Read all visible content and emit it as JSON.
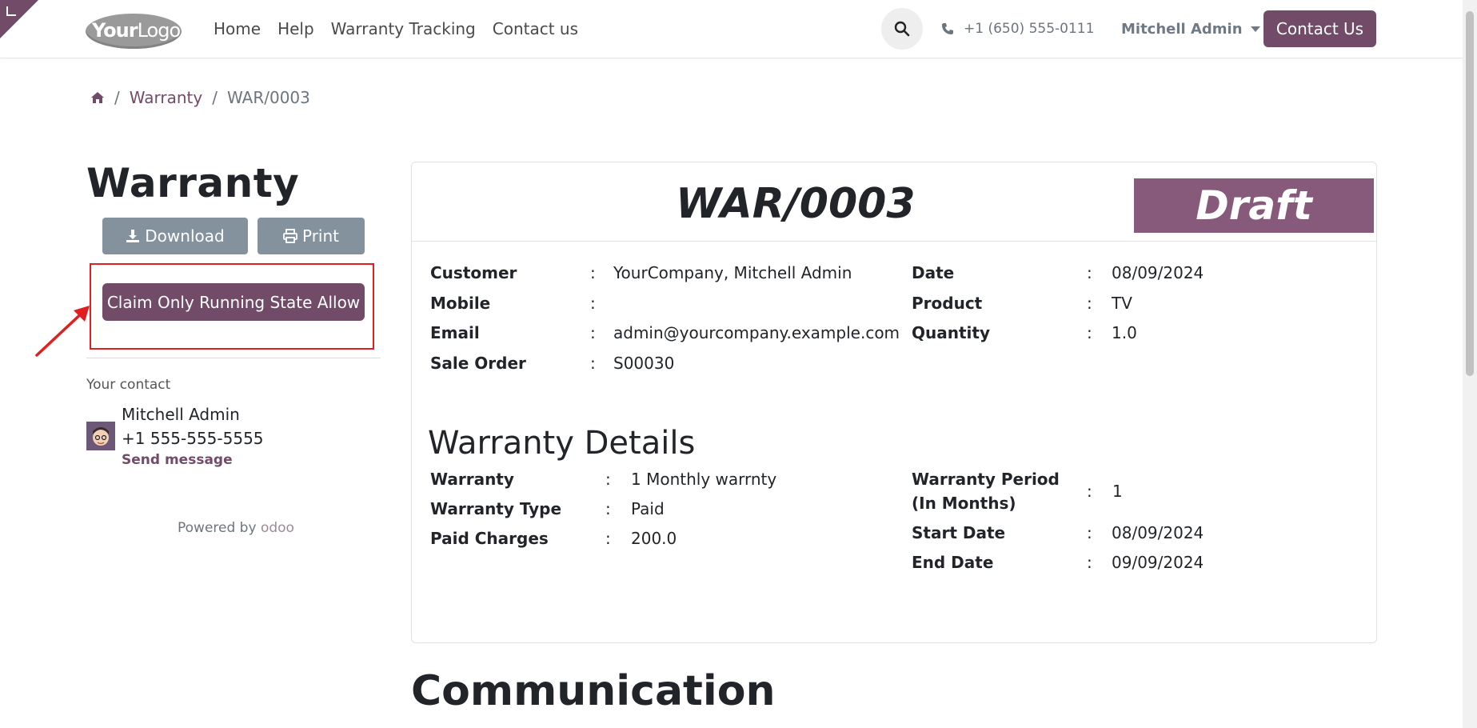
{
  "header": {
    "logo_text_bold": "Your",
    "logo_text_rest": "Logo",
    "nav": [
      "Home",
      "Help",
      "Warranty Tracking",
      "Contact us"
    ],
    "phone": "+1 (650) 555-0111",
    "user": "Mitchell Admin",
    "contact_btn": "Contact Us"
  },
  "breadcrumb": {
    "home_icon": "home-icon",
    "separator": "/",
    "items": [
      "Warranty",
      "WAR/0003"
    ]
  },
  "sidebar": {
    "title": "Warranty",
    "download": "Download",
    "print": "Print",
    "claim": "Claim Only Running State Allow",
    "your_contact": "Your contact",
    "contact_name": "Mitchell Admin",
    "contact_phone": "+1 555-555-5555",
    "send_message": "Send message",
    "powered_by": "Powered by",
    "powered_brand": "odoo"
  },
  "record": {
    "number": "WAR/0003",
    "status": "Draft",
    "left_fields": [
      {
        "label": "Customer",
        "value": "YourCompany, Mitchell Admin"
      },
      {
        "label": "Mobile",
        "value": ""
      },
      {
        "label": "Email",
        "value": "admin@yourcompany.example.com"
      },
      {
        "label": "Sale Order",
        "value": "S00030"
      }
    ],
    "right_fields": [
      {
        "label": "Date",
        "value": "08/09/2024"
      },
      {
        "label": "Product",
        "value": "TV"
      },
      {
        "label": "Quantity",
        "value": "1.0"
      }
    ],
    "details_title": "Warranty Details",
    "detail_left": [
      {
        "label": "Warranty",
        "value": "1 Monthly warrnty"
      },
      {
        "label": "Warranty Type",
        "value": "Paid"
      },
      {
        "label": "Paid Charges",
        "value": "200.0"
      }
    ],
    "detail_right": [
      {
        "label_1": "Warranty Period",
        "label_2": "(In Months)",
        "value": "1"
      },
      {
        "label": "Start Date",
        "value": "08/09/2024"
      },
      {
        "label": "End Date",
        "value": "09/09/2024"
      }
    ],
    "colon": ":"
  },
  "communication": "Communication",
  "colors": {
    "brand": "#714B67",
    "draft": "#875a7b",
    "grey_btn": "#84929e",
    "highlight": "#e02020"
  }
}
